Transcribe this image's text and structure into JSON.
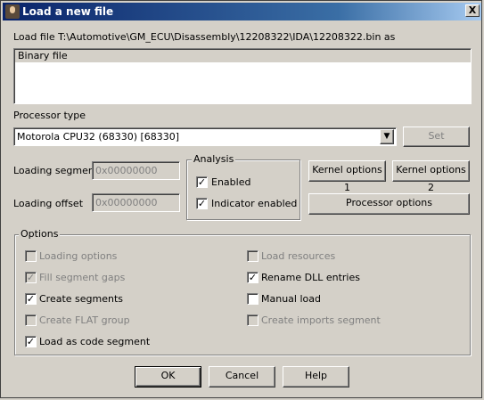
{
  "window": {
    "title": "Load a new file",
    "close_label": "X"
  },
  "load_file": {
    "label": "Load file T:\\Automotive\\GM_ECU\\Disassembly\\12208322\\IDA\\12208322.bin as"
  },
  "format_list": {
    "items": [
      "Binary file"
    ]
  },
  "processor": {
    "label": "Processor type",
    "selected": "Motorola CPU32 (68330) [68330]",
    "set_button": "Set"
  },
  "loading_segment": {
    "label": "Loading segment",
    "value": "0x00000000"
  },
  "loading_offset": {
    "label": "Loading offset",
    "value": "0x00000000"
  },
  "analysis": {
    "title": "Analysis",
    "enabled": "Enabled",
    "indicator": "Indicator enabled"
  },
  "buttons": {
    "kernel1": "Kernel options 1",
    "kernel2": "Kernel options 2",
    "processor_options": "Processor options",
    "ok": "OK",
    "cancel": "Cancel",
    "help": "Help"
  },
  "options": {
    "title": "Options",
    "loading_options": "Loading options",
    "fill_segment_gaps": "Fill segment gaps",
    "create_segments": "Create segments",
    "create_flat_group": "Create FLAT group",
    "load_as_code_segment": "Load as code segment",
    "load_resources": "Load resources",
    "rename_dll_entries": "Rename DLL entries",
    "manual_load": "Manual load",
    "create_imports_segment": "Create imports segment"
  }
}
